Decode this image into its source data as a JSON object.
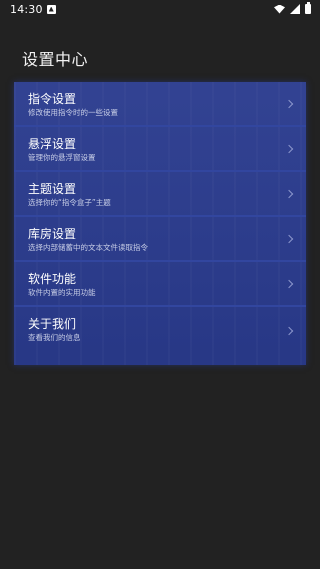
{
  "status_bar": {
    "time": "14:30"
  },
  "page": {
    "title": "设置中心"
  },
  "colors": {
    "background": "#222222",
    "panel": "#2a3b8e",
    "divider": "#32469f"
  },
  "settings": {
    "items": [
      {
        "title": "指令设置",
        "desc": "修改使用指令时的一些设置"
      },
      {
        "title": "悬浮设置",
        "desc": "管理你的悬浮窗设置"
      },
      {
        "title": "主题设置",
        "desc": "选择你的“指令盒子”主题"
      },
      {
        "title": "库房设置",
        "desc": "选择内部储蓄中的文本文件读取指令"
      },
      {
        "title": "软件功能",
        "desc": "软件内置的实用功能"
      },
      {
        "title": "关于我们",
        "desc": "查看我们的信息"
      }
    ]
  }
}
